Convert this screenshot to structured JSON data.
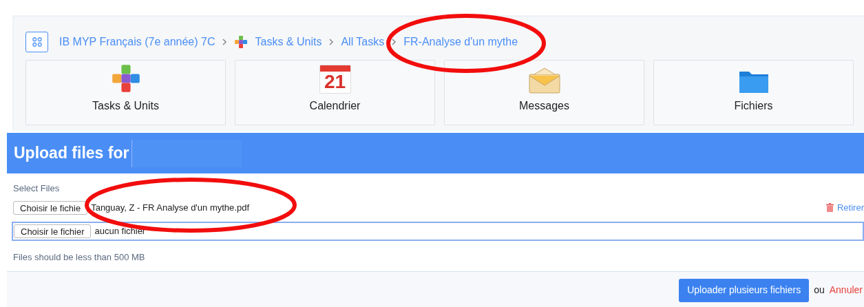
{
  "breadcrumb": [
    {
      "label": "IB MYP Français (7e année) 7C",
      "kind": "text"
    },
    {
      "label": "Tasks & Units",
      "kind": "puzzle"
    },
    {
      "label": "All Tasks",
      "kind": "text"
    },
    {
      "label": "FR-Analyse d'un mythe",
      "kind": "text"
    }
  ],
  "cards": [
    {
      "label": "Tasks & Units",
      "kind": "puzzle"
    },
    {
      "label": "Calendrier",
      "kind": "calendar",
      "day": "21"
    },
    {
      "label": "Messages",
      "kind": "mail"
    },
    {
      "label": "Fichiers",
      "kind": "folder"
    }
  ],
  "upload": {
    "title": "Upload files for",
    "select_label": "Select Files",
    "files": [
      {
        "button": "Choisir le fichie",
        "value": "Tanguay, Z - FR Analyse d'un mythe.pdf",
        "focused": false,
        "remove": "Retirer"
      },
      {
        "button": "Choisir le fichier",
        "value": "aucun fichier",
        "focused": true
      }
    ],
    "note": "Files should be less than 500 MB",
    "submit": "Uploader plusieurs fichiers",
    "or": "ou",
    "cancel": "Annuler"
  },
  "annotations": [
    {
      "kind": "ellipse"
    },
    {
      "kind": "ellipse"
    }
  ]
}
